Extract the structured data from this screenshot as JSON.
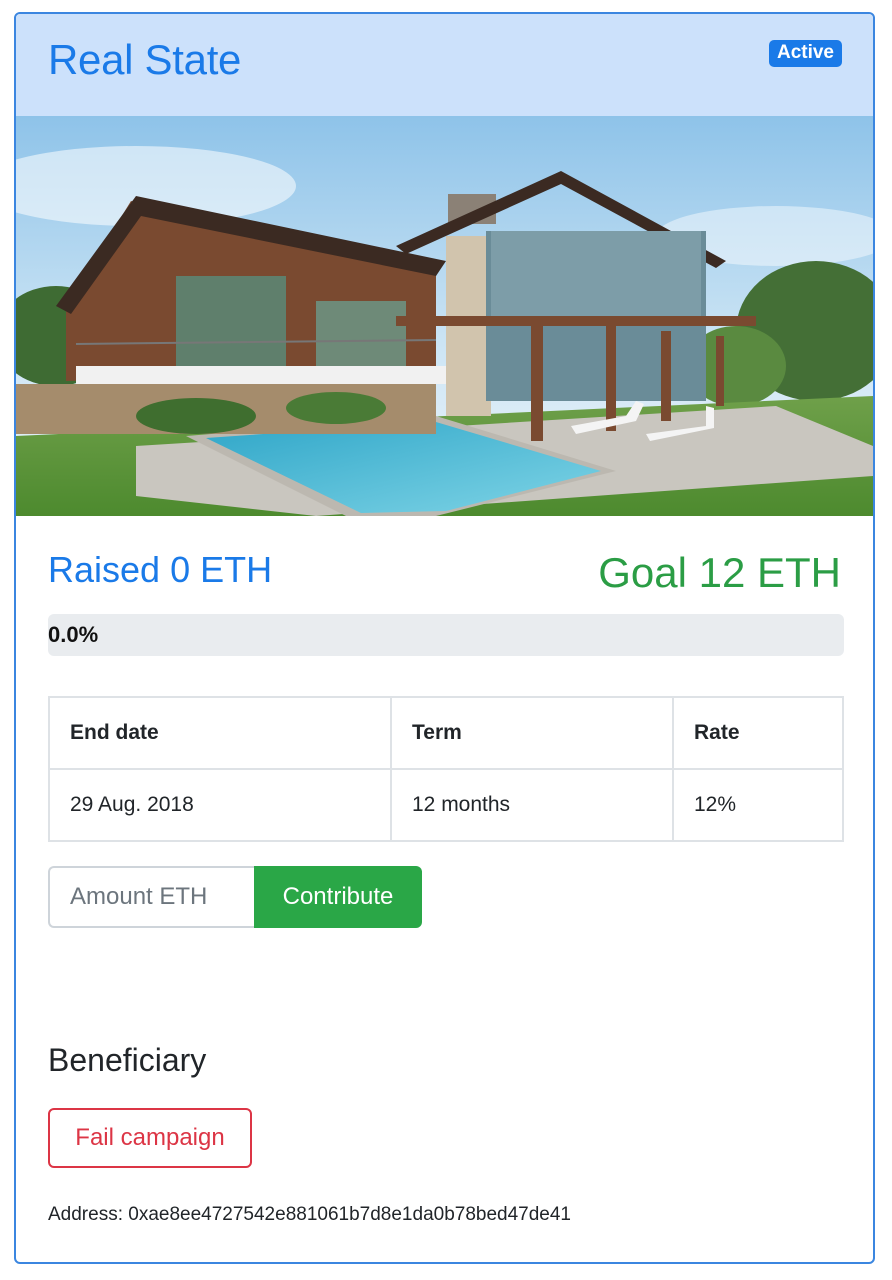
{
  "campaign": {
    "title": "Real State",
    "status_badge": "Active",
    "image_alt": "modern-house-with-pool",
    "raised_text": "Raised 0 ETH",
    "goal_text": "Goal 12 ETH",
    "progress_fraction": 0.0,
    "progress_label": "0.0%"
  },
  "terms_table": {
    "headers": [
      "End date",
      "Term",
      "Rate"
    ],
    "row": [
      "29 Aug. 2018",
      "12 months",
      "12%"
    ]
  },
  "contribute": {
    "placeholder": "Amount ETH",
    "button_label": "Contribute"
  },
  "beneficiary": {
    "heading": "Beneficiary",
    "fail_button_label": "Fail campaign",
    "address_text": "Address: 0xae8ee4727542e881061b7d8e1da0b78bed47de41"
  },
  "colors": {
    "primary": "#1a7ae8",
    "success": "#2aa747",
    "danger": "#dc3545",
    "header_bg": "#cce1fb"
  }
}
